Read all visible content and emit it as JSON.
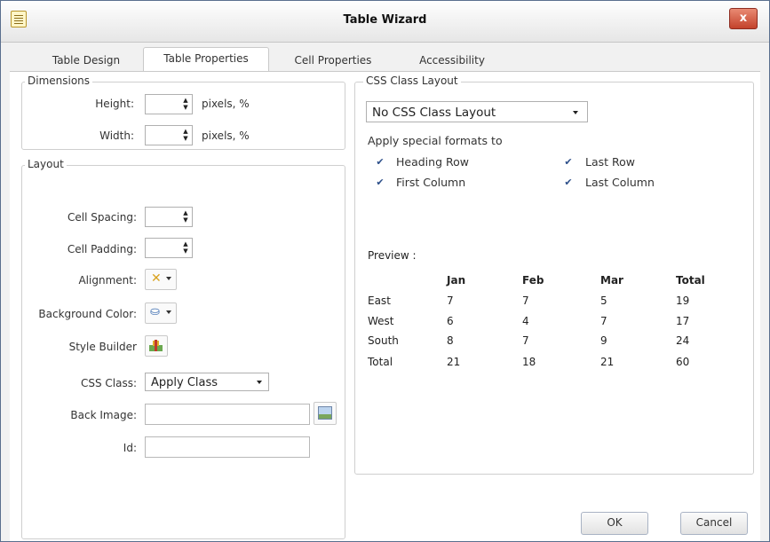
{
  "window": {
    "title": "Table Wizard",
    "close_label": "x"
  },
  "tabs": [
    {
      "label": "Table Design"
    },
    {
      "label": "Table Properties"
    },
    {
      "label": "Cell Properties"
    },
    {
      "label": "Accessibility"
    }
  ],
  "dimensions": {
    "legend": "Dimensions",
    "height_label": "Height:",
    "width_label": "Width:",
    "height_unit": "pixels, %",
    "width_unit": "pixels, %"
  },
  "layout": {
    "legend": "Layout",
    "cell_spacing_label": "Cell Spacing:",
    "cell_padding_label": "Cell Padding:",
    "alignment_label": "Alignment:",
    "bg_color_label": "Background Color:",
    "style_builder_label": "Style Builder",
    "css_class_label": "CSS Class:",
    "css_class_value": "Apply Class",
    "back_image_label": "Back Image:",
    "id_label": "Id:"
  },
  "css_layout": {
    "legend": "CSS Class Layout",
    "selected": "No CSS Class Layout",
    "apply_label": "Apply special formats to",
    "options": [
      {
        "label": "Heading Row",
        "checked": true
      },
      {
        "label": "First Column",
        "checked": true
      },
      {
        "label": "Last Row",
        "checked": true
      },
      {
        "label": "Last Column",
        "checked": true
      }
    ]
  },
  "preview": {
    "label": "Preview :",
    "headers": [
      "",
      "Jan",
      "Feb",
      "Mar",
      "Total"
    ],
    "rows": [
      [
        "East",
        "7",
        "7",
        "5",
        "19"
      ],
      [
        "West",
        "6",
        "4",
        "7",
        "17"
      ],
      [
        "South",
        "8",
        "7",
        "9",
        "24"
      ],
      [
        "Total",
        "21",
        "18",
        "21",
        "60"
      ]
    ]
  },
  "buttons": {
    "ok": "OK",
    "cancel": "Cancel"
  },
  "colors": {
    "accent": "#2d4f8a",
    "close": "#c3422b"
  }
}
